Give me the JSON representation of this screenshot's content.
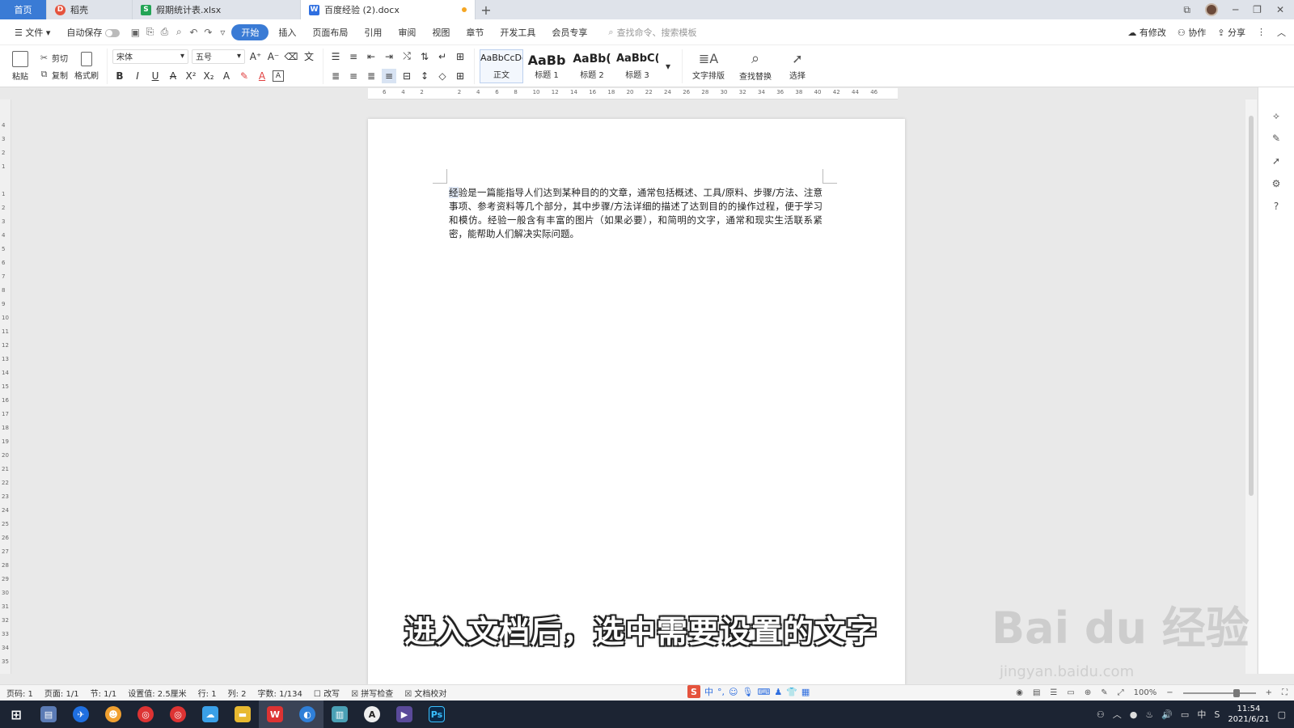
{
  "tabs": {
    "home": "首页",
    "t1": "稻壳",
    "t2": "假期统计表.xlsx",
    "active": "百度经验 (2).docx"
  },
  "menubar": {
    "file": "文件",
    "autosave": "自动保存",
    "items": [
      "开始",
      "插入",
      "页面布局",
      "引用",
      "审阅",
      "视图",
      "章节",
      "开发工具",
      "会员专享"
    ],
    "search_placeholder": "查找命令、搜索模板",
    "right": [
      "有修改",
      "协作",
      "分享"
    ]
  },
  "ribbon": {
    "paste": "粘贴",
    "cut": "剪切",
    "copy": "复制",
    "format_painter": "格式刷",
    "font_name": "宋体",
    "font_size": "五号",
    "styles": [
      {
        "sample": "AaBbCcDd",
        "label": "正文"
      },
      {
        "sample": "AaBb",
        "label": "标题 1"
      },
      {
        "sample": "AaBb(",
        "label": "标题 2"
      },
      {
        "sample": "AaBbC(",
        "label": "标题 3"
      }
    ],
    "text_layout": "文字排版",
    "find_replace": "查找替换",
    "select": "选择"
  },
  "ruler": {
    "h_ticks": [
      "6",
      "4",
      "2",
      "",
      "2",
      "4",
      "6",
      "8",
      "10",
      "12",
      "14",
      "16",
      "18",
      "20",
      "22",
      "24",
      "26",
      "28",
      "30",
      "32",
      "34",
      "36",
      "38",
      "40",
      "42",
      "44",
      "46"
    ],
    "v_ticks": [
      "4",
      "3",
      "2",
      "1",
      "",
      "1",
      "2",
      "3",
      "4",
      "5",
      "6",
      "7",
      "8",
      "9",
      "10",
      "11",
      "12",
      "13",
      "14",
      "15",
      "16",
      "17",
      "18",
      "19",
      "20",
      "21",
      "22",
      "23",
      "24",
      "25",
      "26",
      "27",
      "28",
      "29",
      "30",
      "31",
      "32",
      "33",
      "34",
      "35"
    ]
  },
  "document": {
    "selected": "经",
    "body": "验是一篇能指导人们达到某种目的的文章，通常包括概述、工具/原料、步骤/方法、注意事项、参考资料等几个部分，其中步骤/方法详细的描述了达到目的的操作过程，便于学习和模仿。经验一般含有丰富的图片（如果必要），和简明的文字，通常和现实生活联系紧密，能帮助人们解决实际问题。"
  },
  "subtitle": "进入文档后，选中需要设置的文字",
  "watermark": {
    "brand": "Bai du 经验",
    "url": "jingyan.baidu.com"
  },
  "statusbar": {
    "page_num": "页码: 1",
    "pages": "页面: 1/1",
    "section": "节: 1/1",
    "position": "设置值: 2.5厘米",
    "row": "行: 1",
    "col": "列: 2",
    "words": "字数: 1/134",
    "revise": "改写",
    "spell": "拼写检查",
    "proof": "文档校对",
    "zoom": "100%"
  },
  "ime": {
    "lang": "中"
  },
  "taskbar": {
    "time": "11:54",
    "date": "2021/6/21",
    "ime_lang": "中"
  },
  "colors": {
    "accent": "#3a7bd5",
    "tab_home": "#3a7bd5",
    "taskbar": "#1c2433"
  }
}
